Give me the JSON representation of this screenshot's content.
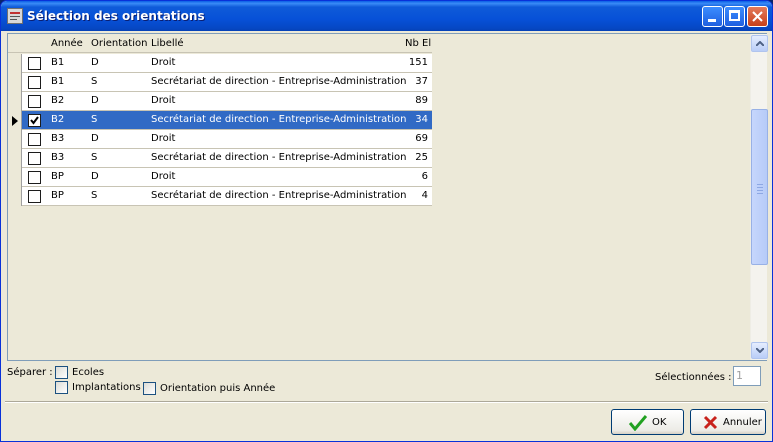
{
  "window": {
    "title": "Sélection des orientations"
  },
  "grid": {
    "columns": [
      "Année",
      "Orientation",
      "Libellé",
      "Nb El"
    ],
    "rows": [
      {
        "annee": "B1",
        "orientation": "D",
        "libelle": "Droit",
        "nb": "151",
        "checked": false,
        "selected": false
      },
      {
        "annee": "B1",
        "orientation": "S",
        "libelle": "Secrétariat de direction - Entreprise-Administration",
        "nb": "37",
        "checked": false,
        "selected": false
      },
      {
        "annee": "B2",
        "orientation": "D",
        "libelle": "Droit",
        "nb": "89",
        "checked": false,
        "selected": false
      },
      {
        "annee": "B2",
        "orientation": "S",
        "libelle": "Secrétariat de direction - Entreprise-Administration",
        "nb": "34",
        "checked": true,
        "selected": true
      },
      {
        "annee": "B3",
        "orientation": "D",
        "libelle": "Droit",
        "nb": "69",
        "checked": false,
        "selected": false
      },
      {
        "annee": "B3",
        "orientation": "S",
        "libelle": "Secrétariat de direction - Entreprise-Administration",
        "nb": "25",
        "checked": false,
        "selected": false
      },
      {
        "annee": "BP",
        "orientation": "D",
        "libelle": "Droit",
        "nb": "6",
        "checked": false,
        "selected": false
      },
      {
        "annee": "BP",
        "orientation": "S",
        "libelle": "Secrétariat de direction - Entreprise-Administration",
        "nb": "4",
        "checked": false,
        "selected": false
      }
    ]
  },
  "options": {
    "separate_label": "Séparer :",
    "ecoles": "Ecoles",
    "implantations": "Implantations",
    "orientation_puis_annee": "Orientation puis Année"
  },
  "selection": {
    "label": "Sélectionnées :",
    "count": "1"
  },
  "buttons": {
    "ok": "OK",
    "cancel": "Annuler"
  },
  "colors": {
    "selection": "#316ac5",
    "titlebar": "#0751d8",
    "ok_check": "#21a121",
    "cancel_x": "#c8221c"
  }
}
